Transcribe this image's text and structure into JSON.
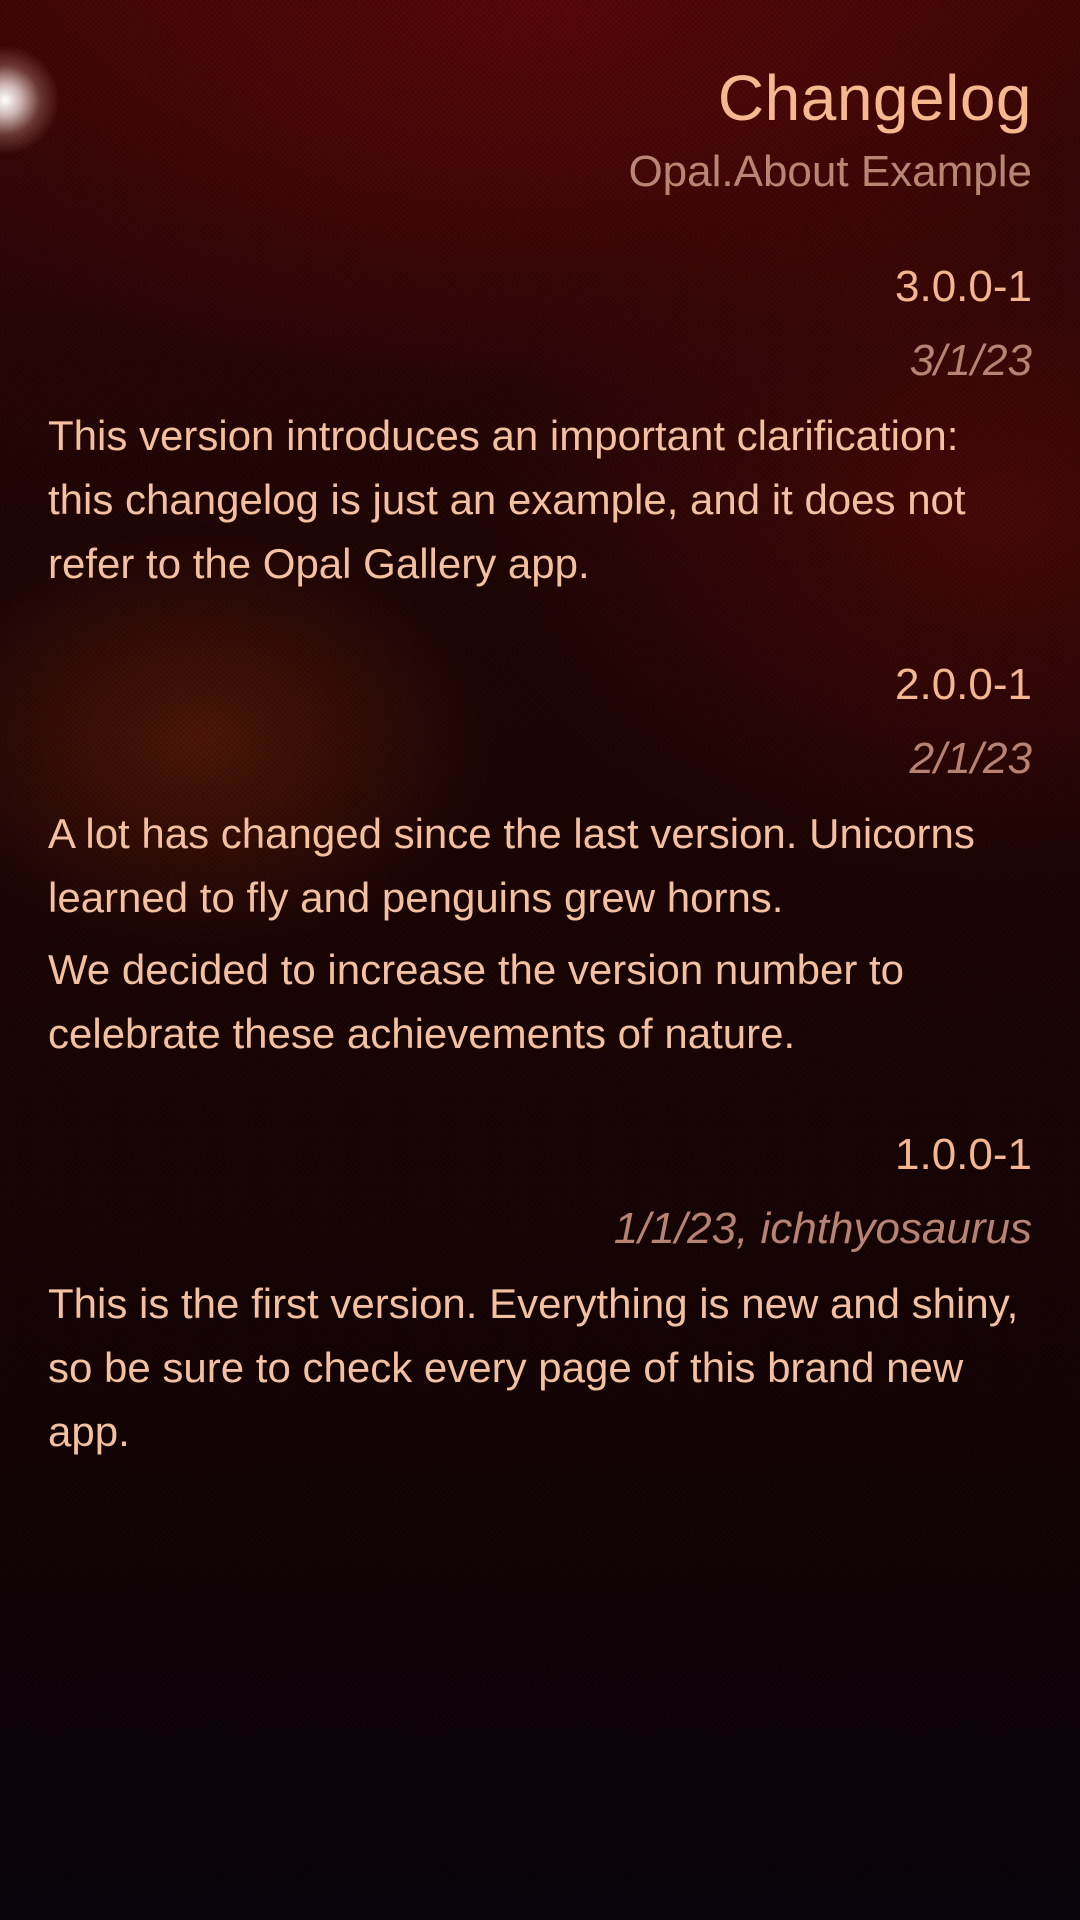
{
  "header": {
    "title": "Changelog",
    "subtitle": "Opal.About Example"
  },
  "entries": [
    {
      "version": "3.0.0-1",
      "meta": "3/1/23",
      "paragraphs": [
        "This version introduces an important clarification: this changelog is just an example, and it does not refer to the Opal Gallery app."
      ]
    },
    {
      "version": "2.0.0-1",
      "meta": "2/1/23",
      "paragraphs": [
        "A lot has changed since the last version. Unicorns learned to fly and penguins grew horns.",
        "We decided to increase the version number to celebrate these achievements of nature."
      ]
    },
    {
      "version": "1.0.0-1",
      "meta": "1/1/23, ichthyosaurus",
      "paragraphs": [
        "This is the first version. Everything is new and shiny, so be sure to check every page of this brand new app."
      ]
    }
  ]
}
